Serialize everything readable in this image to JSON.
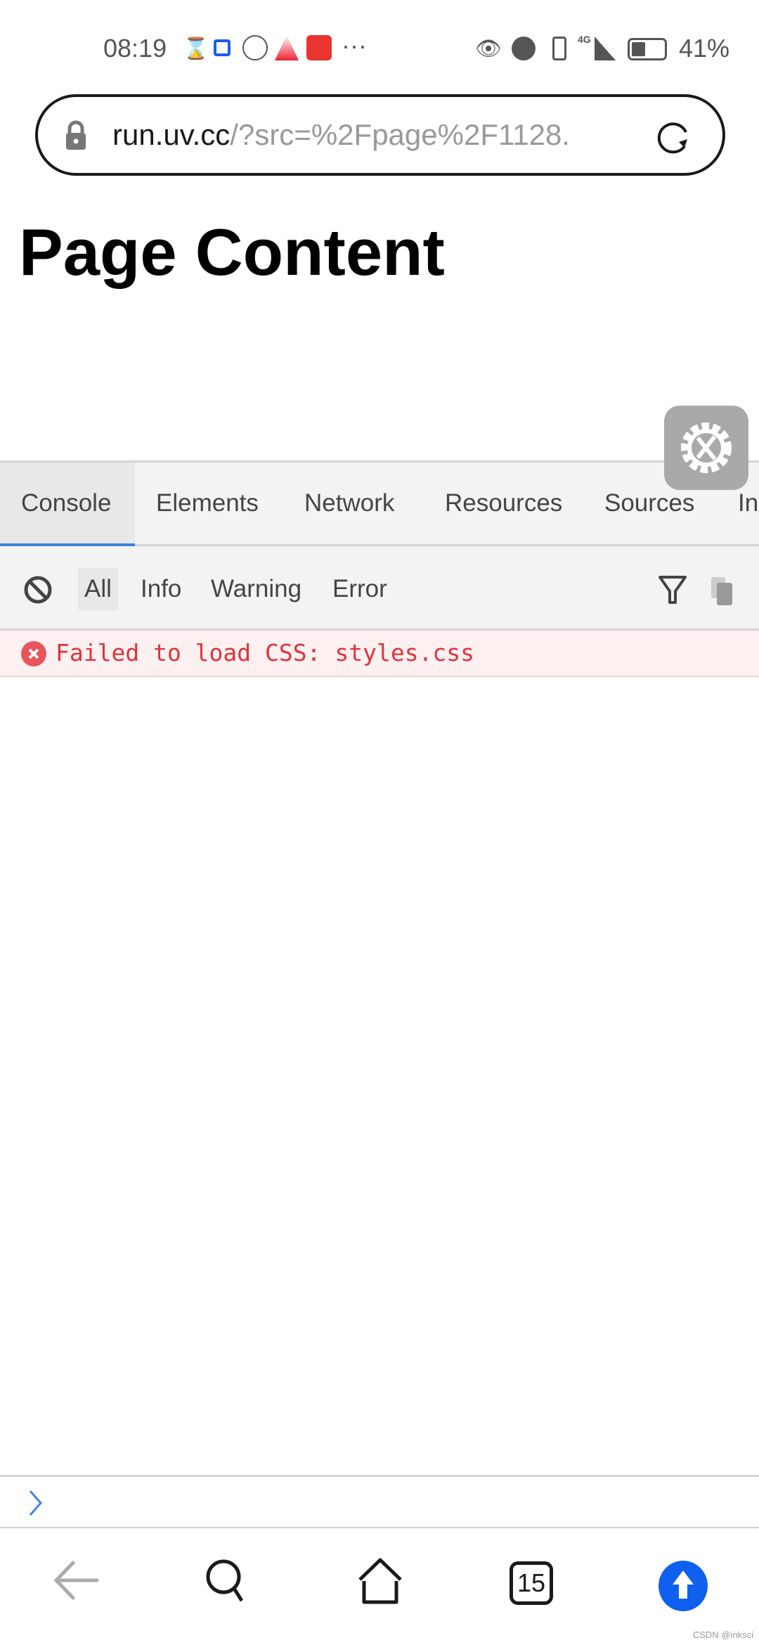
{
  "status_bar": {
    "time": "08:19",
    "battery": "41%",
    "network": "4G",
    "icons": [
      "hourglass-icon",
      "app-icon",
      "jingxi-icon",
      "app-icon",
      "app-icon",
      "more-icon",
      "eye-icon",
      "alarm-icon",
      "vibrate-icon",
      "signal-icon",
      "battery-icon"
    ],
    "more": "···"
  },
  "browser": {
    "url_host": "run.uv.cc",
    "url_path": "/?src=%2Fpage%2F1128.",
    "tab_count": "15"
  },
  "page": {
    "heading": "Page Content"
  },
  "devtools": {
    "tabs": [
      {
        "label": "Console",
        "active": true
      },
      {
        "label": "Elements"
      },
      {
        "label": "Network"
      },
      {
        "label": "Resources"
      },
      {
        "label": "Sources"
      },
      {
        "label": "In"
      }
    ],
    "levels": [
      {
        "label": "All",
        "selected": true
      },
      {
        "label": "Info"
      },
      {
        "label": "Warning"
      },
      {
        "label": "Error"
      }
    ],
    "logs": [
      {
        "level": "error",
        "text": "Failed to load CSS: styles.css"
      }
    ],
    "accent": "#3c83e0",
    "error_color": "#e0333a"
  },
  "watermark": "CSDN @inksci"
}
